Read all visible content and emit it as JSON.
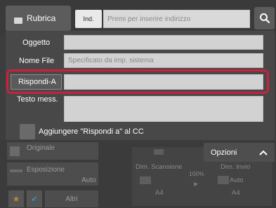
{
  "header": {
    "rubrica_label": "Rubrica",
    "ind_label": "Ind.",
    "address_placeholder": "Premi per inserire indirizzo"
  },
  "form": {
    "oggetto_label": "Oggetto",
    "nome_file_label": "Nome File",
    "nome_file_placeholder": "Specificato da imp. sistema",
    "rispondi_label": "Rispondi-A",
    "testo_label": "Testo mess.",
    "cc_label": "Aggiungere \"Rispondi a\" al CC"
  },
  "settings": {
    "originale_label": "Originale",
    "esposizione_label": "Esposizione",
    "esposizione_value": "Auto",
    "altri_label": "Altri",
    "dim_scansione_label": "Dim. Scansione",
    "dim_invio_label": "Dim. Invio",
    "dim_invio_value": "Auto",
    "scale_value": "100%",
    "scan_size": "A4",
    "send_size": "A4",
    "opzioni_label": "Opzioni"
  },
  "colors": {
    "highlight": "#cc1f3b"
  }
}
